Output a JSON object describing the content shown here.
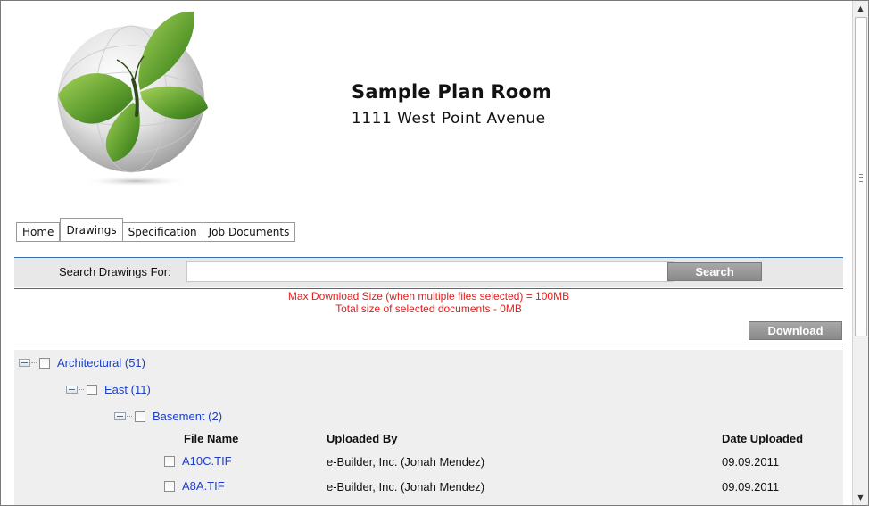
{
  "header": {
    "title": "Sample Plan Room",
    "address": "1111 West Point Avenue",
    "logo_icon": "butterfly-globe-icon",
    "colors": {
      "butterfly": "#6aa83a",
      "globe": "#d9d9d9"
    }
  },
  "tabs": [
    {
      "label": "Home",
      "active": false
    },
    {
      "label": "Drawings",
      "active": true
    },
    {
      "label": "Specification",
      "active": false
    },
    {
      "label": "Job Documents",
      "active": false
    }
  ],
  "search": {
    "label": "Search Drawings For:",
    "value": "",
    "placeholder": "",
    "button_label": "Search"
  },
  "messages": {
    "max_download": "Max Download Size (when multiple files selected) = 100MB",
    "total_selected": "Total size of selected documents - 0MB",
    "color": "#e02020"
  },
  "download_label": "Download",
  "tree": {
    "level1": "Architectural (51)",
    "level2": "East (11)",
    "level3": "Basement (2)",
    "columns": {
      "file_name": "File Name",
      "uploaded_by": "Uploaded By",
      "date_uploaded": "Date Uploaded"
    },
    "files": [
      {
        "name": "A10C.TIF",
        "uploaded_by": "e-Builder, Inc. (Jonah Mendez)",
        "date": "09.09.2011"
      },
      {
        "name": "A8A.TIF",
        "uploaded_by": "e-Builder, Inc. (Jonah Mendez)",
        "date": "09.09.2011"
      }
    ]
  },
  "accent_color": "#3b6ea5",
  "link_color": "#1c3ec8"
}
